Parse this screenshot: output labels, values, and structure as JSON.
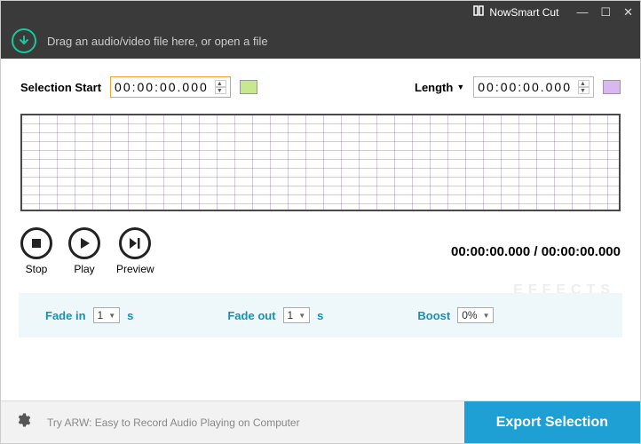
{
  "app": {
    "title": "NowSmart Cut"
  },
  "dropzone": {
    "text": "Drag an audio/video file here, or open a file"
  },
  "selection": {
    "start_label": "Selection Start",
    "start_value": "00:00:00.000",
    "start_color": "#c7e88f",
    "length_label": "Length",
    "length_value": "00:00:00.000",
    "length_color": "#d9b8f2"
  },
  "transport": {
    "stop": "Stop",
    "play": "Play",
    "preview": "Preview",
    "current": "00:00:00.000",
    "total": "00:00:00.000"
  },
  "effects": {
    "watermark": "EFFECTS",
    "fade_in_label": "Fade in",
    "fade_in_value": "1",
    "fade_in_unit": "s",
    "fade_out_label": "Fade out",
    "fade_out_value": "1",
    "fade_out_unit": "s",
    "boost_label": "Boost",
    "boost_value": "0%"
  },
  "footer": {
    "tip": "Try ARW: Easy to Record Audio Playing on Computer",
    "export": "Export Selection"
  }
}
